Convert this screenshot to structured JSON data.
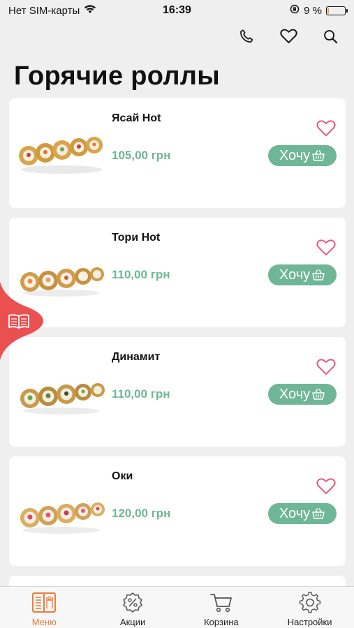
{
  "status_bar": {
    "carrier": "Нет SIM-карты",
    "time": "16:39",
    "battery_percent": "9 %",
    "battery_level": 0.09,
    "icons": [
      "wifi-icon",
      "orientation-lock-icon",
      "battery-icon"
    ]
  },
  "header": {
    "icons": [
      "phone-icon",
      "heart-icon",
      "search-icon"
    ]
  },
  "page": {
    "title": "Горячие роллы"
  },
  "products": [
    {
      "name": "Ясай Hot",
      "price": "105,00 грн",
      "button": "Хочу"
    },
    {
      "name": "Тори Hot",
      "price": "110,00 грн",
      "button": "Хочу"
    },
    {
      "name": "Динамит",
      "price": "110,00 грн",
      "button": "Хочу"
    },
    {
      "name": "Оки",
      "price": "120,00 грн",
      "button": "Хочу"
    }
  ],
  "side_tab": {
    "icon": "catalog-book-icon"
  },
  "tab_bar": {
    "tabs": [
      {
        "label": "Меню",
        "icon": "menu-book-icon",
        "active": true
      },
      {
        "label": "Акции",
        "icon": "discount-badge-icon",
        "active": false
      },
      {
        "label": "Корзина",
        "icon": "cart-icon",
        "active": false
      },
      {
        "label": "Настройки",
        "icon": "gear-icon",
        "active": false
      }
    ]
  },
  "colors": {
    "accent_green": "#6fb696",
    "accent_orange": "#ef7b3a",
    "heart_pink": "#e5597a",
    "side_tab_red": "#e9504f",
    "background": "#efefef"
  }
}
